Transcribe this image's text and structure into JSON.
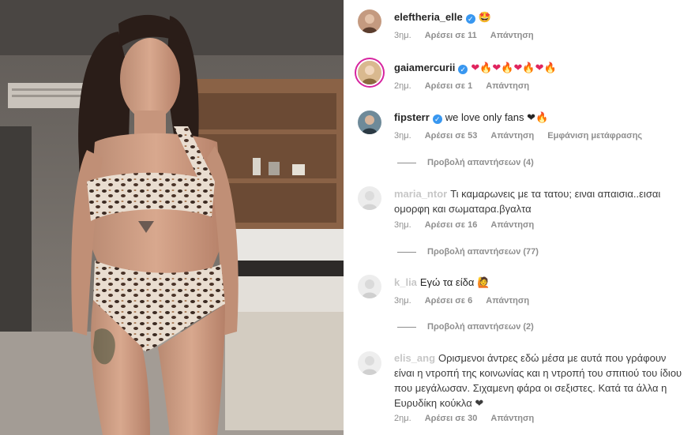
{
  "comments": [
    {
      "username": "eleftheria_elle",
      "verified": true,
      "text": "🤩",
      "time": "3ημ.",
      "likes": "Αρέσει σε 11",
      "reply": "Απάντηση"
    },
    {
      "username": "gaiamercurii",
      "verified": true,
      "text": "❤🔥❤🔥❤🔥❤🔥",
      "time": "2ημ.",
      "likes": "Αρέσει σε 1",
      "reply": "Απάντηση"
    },
    {
      "username": "fipsterr",
      "verified": true,
      "text": "we love only fans ❤🔥",
      "time": "3ημ.",
      "likes": "Αρέσει σε 53",
      "reply": "Απάντηση",
      "translate": "Εμφάνιση μετάφρασης",
      "view_replies": "Προβολή απαντήσεων (4)"
    },
    {
      "username": "maria_ntor",
      "verified": false,
      "text": "Τι καμαρωνεις με τα τατου; ειναι απαισια..εισαι ομορφη και σωματαρα.βγαλτα",
      "time": "3ημ.",
      "likes": "Αρέσει σε 16",
      "reply": "Απάντηση",
      "view_replies": "Προβολή απαντήσεων (77)"
    },
    {
      "username": "k_lia",
      "verified": false,
      "text": "Εγώ τα είδα 🙋",
      "time": "3ημ.",
      "likes": "Αρέσει σε 6",
      "reply": "Απάντηση",
      "view_replies": "Προβολή απαντήσεων (2)"
    },
    {
      "username": "elis_ang",
      "verified": false,
      "text": "Ορισμενοι άντρες εδώ μέσα με αυτά που γράφουν είναι η ντροπή της κοινωνίας και η ντροπή του σπιτιού του ίδιου που μεγάλωσαν. Σιχαμενη φάρα οι σεξιστες. Κατά τα άλλα η Ευρυδίκη κούκλα ❤",
      "time": "2ημ.",
      "likes": "Αρέσει σε 30",
      "reply": "Απάντηση"
    }
  ],
  "icons": {
    "verified": "verified-badge-icon",
    "avatar": "user-avatar"
  },
  "colors": {
    "verified_blue": "#3897f0",
    "meta_gray": "#8e8e8e",
    "text_dark": "#262626",
    "story_ring": "#d6249f"
  }
}
